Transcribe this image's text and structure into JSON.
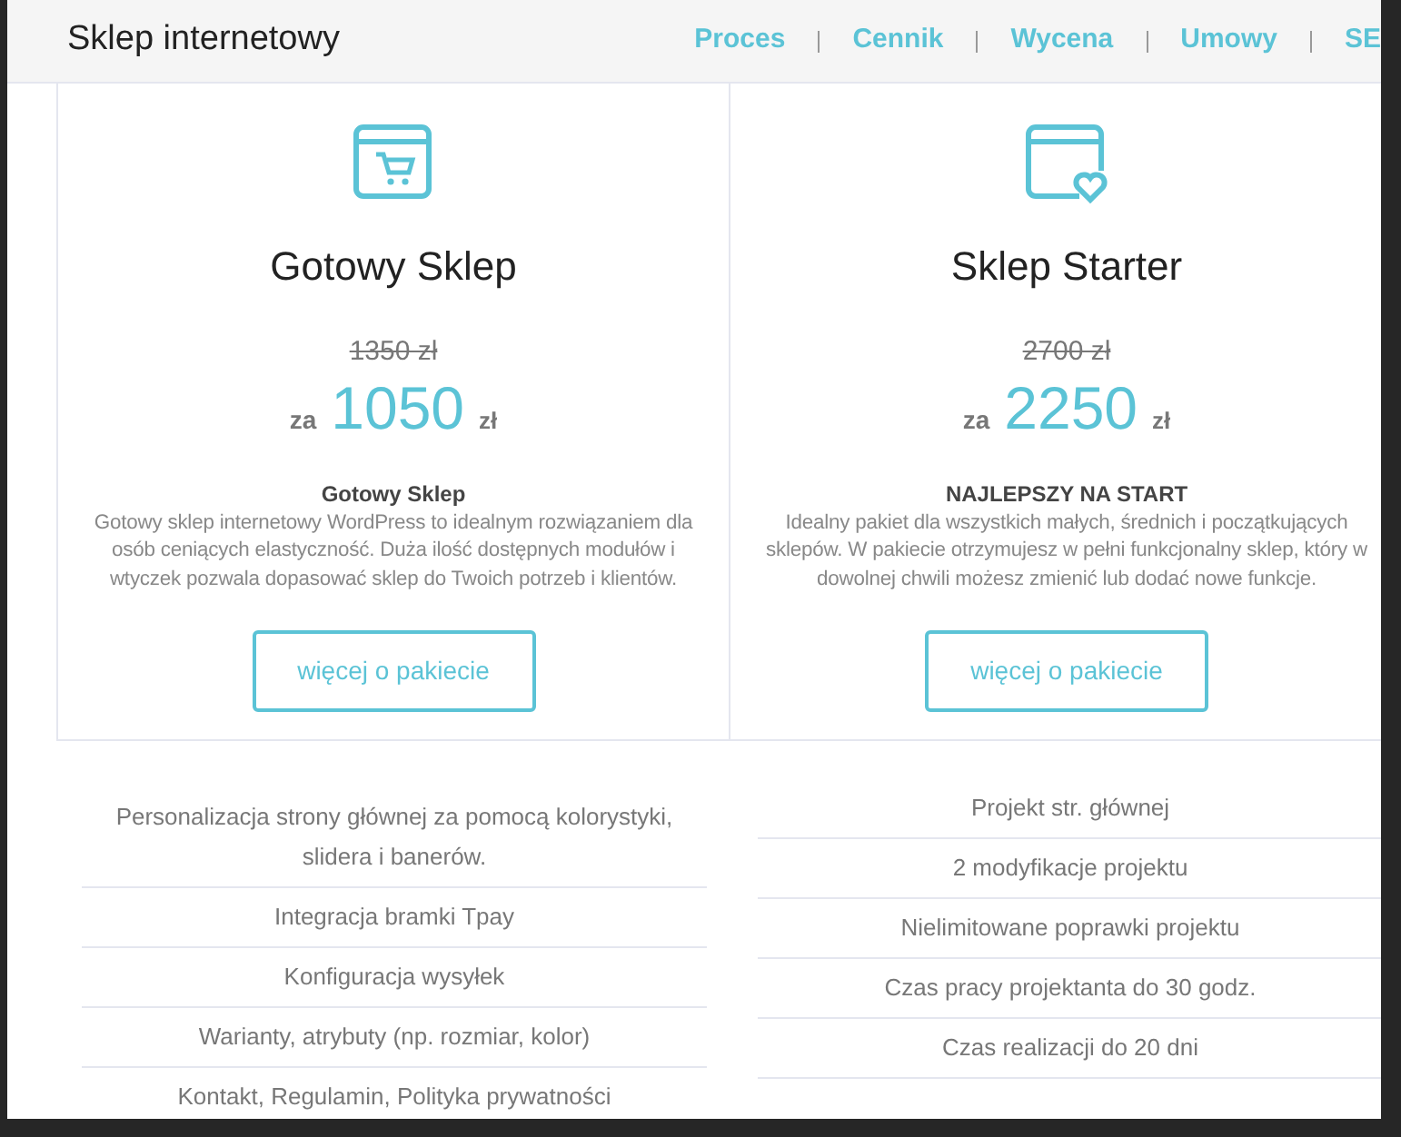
{
  "header": {
    "title": "Sklep internetowy",
    "nav": [
      {
        "label": "Proces"
      },
      {
        "label": "Cennik"
      },
      {
        "label": "Wycena"
      },
      {
        "label": "Umowy"
      },
      {
        "label": "SE"
      }
    ]
  },
  "packages": [
    {
      "kind": "cart",
      "name": "Gotowy Sklep",
      "old_price": "1350 zł",
      "prefix": "za",
      "price": "1050",
      "currency": "zł",
      "subtitle": "Gotowy Sklep",
      "description": "Gotowy sklep internetowy WordPress to idealnym rozwiązaniem dla osób ceniących elastyczność. Duża ilość dostępnych modułów i wtyczek pozwala dopasować sklep do Twoich potrzeb i klientów.",
      "button": "więcej o pakiecie",
      "features": [
        "Personalizacja strony głównej za pomocą kolorystyki, slidera i banerów.",
        "Integracja bramki Tpay",
        "Konfiguracja wysyłek",
        "Warianty, atrybuty (np. rozmiar, kolor)",
        "Kontakt, Regulamin, Polityka prywatności"
      ]
    },
    {
      "kind": "heart",
      "name": "Sklep Starter",
      "old_price": "2700 zł",
      "prefix": "za",
      "price": "2250",
      "currency": "zł",
      "subtitle": "NAJLEPSZY NA START",
      "description": "Idealny pakiet dla wszystkich małych, średnich i początkujących sklepów. W pakiecie otrzymujesz w pełni funkcjonalny sklep, który w dowolnej chwili możesz zmienić lub dodać nowe funkcje.",
      "button": "więcej o pakiecie",
      "features": [
        "Projekt str. głównej",
        "2 modyfikacje projektu",
        "Nielimitowane poprawki projektu",
        "Czas pracy projektanta do 30 godz.",
        "Czas realizacji do 20 dni"
      ]
    }
  ]
}
